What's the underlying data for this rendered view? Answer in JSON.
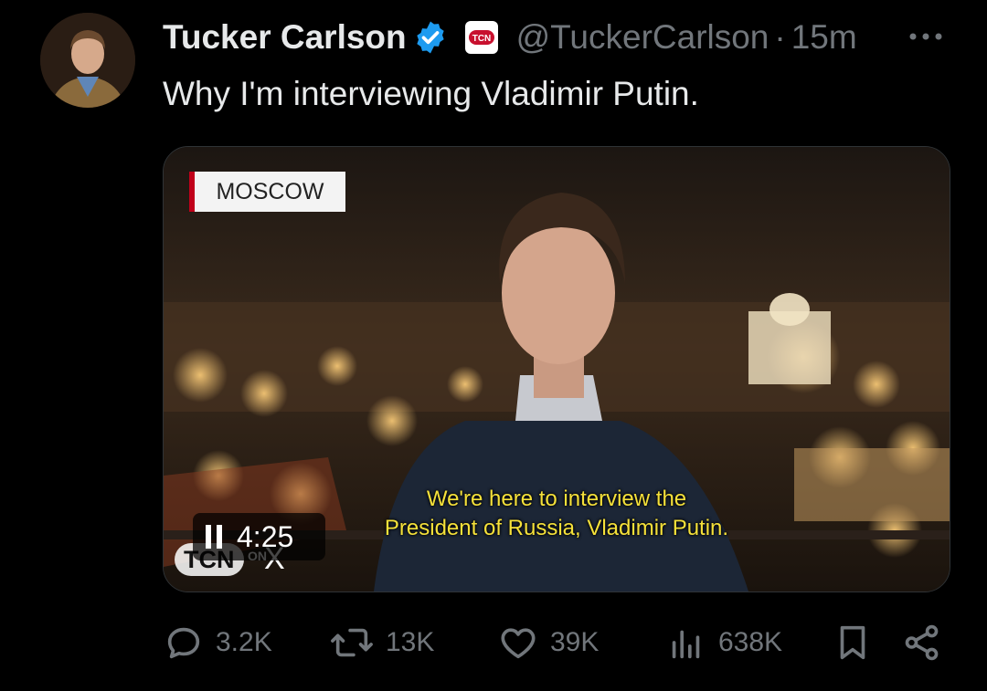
{
  "tweet": {
    "author_name": "Tucker Carlson",
    "handle": "@TuckerCarlson",
    "separator": "·",
    "time": "15m",
    "affiliation_badge": "TCN",
    "text": "Why I'm interviewing Vladimir Putin.",
    "icons": {
      "verified": "verified-badge-icon",
      "more": "more-icon"
    },
    "accent_color": "#1d9bf0"
  },
  "video": {
    "location_label": "MOSCOW",
    "subtitle_line1": "We're here to interview the",
    "subtitle_line2": "President of Russia, Vladimir Putin.",
    "duration": "4:25",
    "watermark": "TCN",
    "watermark_suffix": "ON",
    "watermark_x": "X",
    "subtitle_color": "#f5e13a"
  },
  "actions": {
    "replies": "3.2K",
    "reposts": "13K",
    "likes": "39K",
    "views": "638K",
    "icons": [
      "reply-icon",
      "repost-icon",
      "like-icon",
      "views-icon",
      "bookmark-icon",
      "share-icon"
    ]
  }
}
